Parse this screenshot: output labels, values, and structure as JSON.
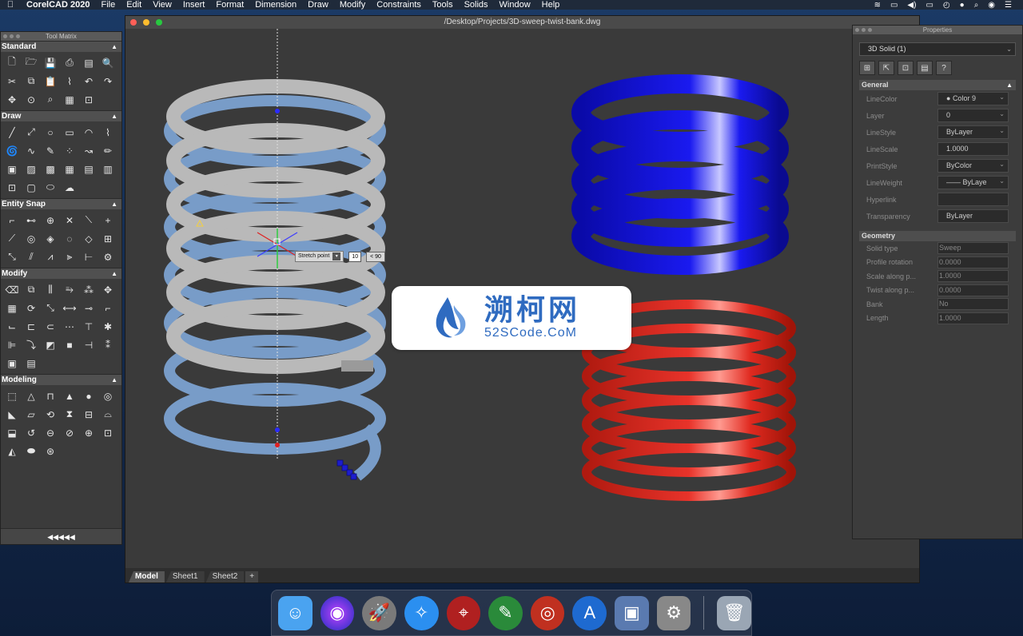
{
  "menubar": {
    "app_name": "CorelCAD 2020",
    "items": [
      "File",
      "Edit",
      "View",
      "Insert",
      "Format",
      "Dimension",
      "Draw",
      "Modify",
      "Constraints",
      "Tools",
      "Solids",
      "Window",
      "Help"
    ]
  },
  "tool_matrix": {
    "title": "Tool Matrix",
    "sections": [
      {
        "label": "Standard"
      },
      {
        "label": "Draw"
      },
      {
        "label": "Entity Snap"
      },
      {
        "label": "Modify"
      },
      {
        "label": "Modeling"
      }
    ],
    "collapse_label": "◀◀◀◀◀"
  },
  "main_window": {
    "title": "/Desktop/Projects/3D-sweep-twist-bank.dwg",
    "tabs": [
      "Model",
      "Sheet1",
      "Sheet2"
    ],
    "add_tab": "+",
    "stretch": {
      "label": "Stretch point",
      "value": "10",
      "angle": "< 90"
    }
  },
  "properties": {
    "title": "Properties",
    "selection": "3D Solid (1)",
    "general_label": "General",
    "general": [
      {
        "k": "LineColor",
        "v": "Color 9"
      },
      {
        "k": "Layer",
        "v": "0"
      },
      {
        "k": "LineStyle",
        "v": "ByLayer"
      },
      {
        "k": "LineScale",
        "v": "1.0000"
      },
      {
        "k": "PrintStyle",
        "v": "ByColor"
      },
      {
        "k": "LineWeight",
        "v": "ByLaye"
      },
      {
        "k": "Hyperlink",
        "v": ""
      },
      {
        "k": "Transparency",
        "v": "ByLayer"
      }
    ],
    "geometry_label": "Geometry",
    "geometry": [
      {
        "k": "Solid type",
        "v": "Sweep"
      },
      {
        "k": "Profile rotation",
        "v": "0.0000"
      },
      {
        "k": "Scale along p...",
        "v": "1.0000"
      },
      {
        "k": "Twist along p...",
        "v": "0.0000"
      },
      {
        "k": "Bank",
        "v": "No"
      },
      {
        "k": "Length",
        "v": "1.0000"
      }
    ],
    "toolbar_help": "?"
  },
  "watermark": {
    "cn": "溯柯网",
    "en": "52SCode.CoM"
  },
  "colors": {
    "helix_blue": "#1010d8",
    "helix_red": "#d8281c",
    "helix_gray": "#b9b9b9",
    "helix_light_blue": "#7fa7d8"
  }
}
